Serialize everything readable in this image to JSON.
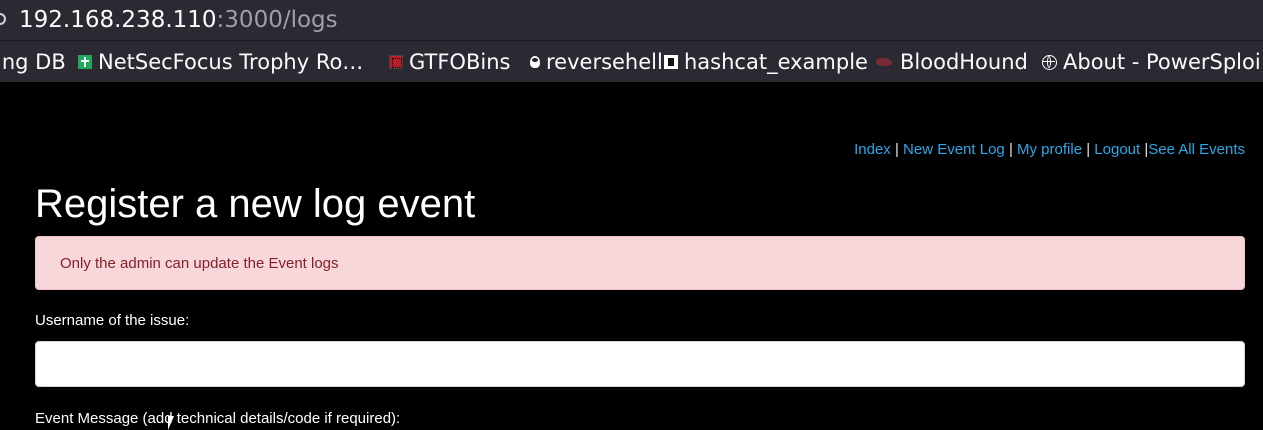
{
  "browser": {
    "url_host": "192.168.238.110",
    "url_path": ":3000/logs",
    "bookmarks": [
      {
        "label": "ing DB",
        "icon": "none"
      },
      {
        "label": "NetSecFocus Trophy Ro…",
        "icon": "green-plus-icon"
      },
      {
        "label": "GTFOBins",
        "icon": "gtfobins-icon"
      },
      {
        "label": "reversehell",
        "icon": "penguin-icon"
      },
      {
        "label": "hashcat_example",
        "icon": "hashcat-icon"
      },
      {
        "label": "BloodHound",
        "icon": "bloodhound-icon"
      },
      {
        "label": "About - PowerSploi",
        "icon": "globe-icon"
      }
    ]
  },
  "nav": {
    "links": [
      "Index",
      "New Event Log",
      "My profile",
      "Logout",
      "See All Events"
    ],
    "separator": "|"
  },
  "page": {
    "title": "Register a new log event",
    "alert": "Only the admin can update the Event logs",
    "username_label": "Username of the issue:",
    "username_value": "",
    "message_label": "Event Message (add technical details/code if required):"
  },
  "colors": {
    "link": "#2aa8e8",
    "alert_bg": "#f8d7da",
    "alert_text": "#842029",
    "chrome_bg": "#2b2a33"
  }
}
